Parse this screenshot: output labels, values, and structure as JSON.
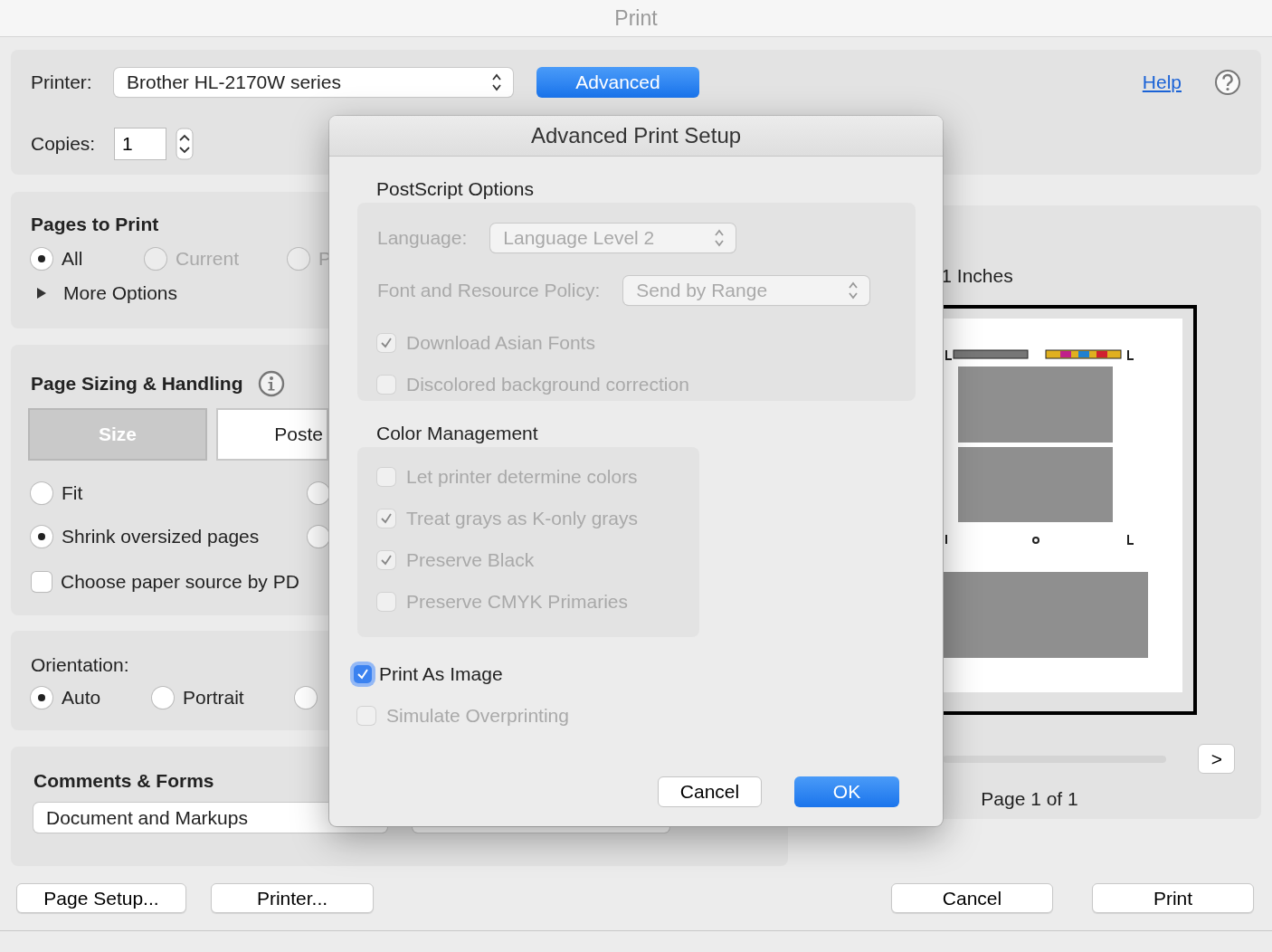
{
  "window": {
    "title": "Print"
  },
  "printer": {
    "label": "Printer:",
    "value": "Brother HL-2170W series"
  },
  "advanced_button": "Advanced",
  "help_link": "Help",
  "copies": {
    "label": "Copies:",
    "value": "1"
  },
  "pages_to_print": {
    "title": "Pages to Print",
    "options": [
      {
        "label": "All",
        "selected": true,
        "disabled": false
      },
      {
        "label": "Current",
        "selected": false,
        "disabled": true
      },
      {
        "label": "P",
        "selected": false,
        "disabled": true
      }
    ],
    "more_options": "More Options"
  },
  "page_sizing": {
    "title": "Page Sizing & Handling",
    "tabs": [
      {
        "label": "Size",
        "selected": true
      },
      {
        "label": "Poste",
        "selected": false
      }
    ],
    "options": [
      {
        "label": "Fit",
        "selected": false
      },
      {
        "selected": false
      },
      {
        "label": "Shrink oversized pages",
        "selected": true
      },
      {
        "selected": false
      }
    ],
    "paper_source": {
      "label": "Choose paper source by PD",
      "checked": false
    }
  },
  "orientation": {
    "label": "Orientation:",
    "options": [
      {
        "label": "Auto",
        "selected": true
      },
      {
        "label": "Portrait",
        "selected": false
      },
      {
        "selected": false
      }
    ]
  },
  "comments_forms": {
    "title": "Comments & Forms",
    "value": "Document and Markups"
  },
  "buttons": {
    "page_setup": "Page Setup...",
    "printer": "Printer...",
    "cancel": "Cancel",
    "print": "Print"
  },
  "preview": {
    "scale": "1 Inches",
    "next": ">",
    "page": "Page 1 of 1"
  },
  "dialog": {
    "title": "Advanced Print Setup",
    "sections": [
      {
        "title": "PostScript Options",
        "rows": [
          {
            "kind": "select",
            "label": "Language:",
            "value": "Language Level 2",
            "disabled": true
          },
          {
            "kind": "select",
            "label": "Font and Resource Policy:",
            "value": "Send by Range",
            "disabled": true
          },
          {
            "kind": "checkbox",
            "label": "Download Asian Fonts",
            "checked": true,
            "disabled": true
          },
          {
            "kind": "checkbox",
            "label": "Discolored background correction",
            "checked": false,
            "disabled": true
          }
        ]
      },
      {
        "title": "Color Management",
        "rows": [
          {
            "kind": "checkbox",
            "label": "Let printer determine colors",
            "checked": false,
            "disabled": true
          },
          {
            "kind": "checkbox",
            "label": "Treat grays as K-only grays",
            "checked": true,
            "disabled": true
          },
          {
            "kind": "checkbox",
            "label": "Preserve Black",
            "checked": true,
            "disabled": true
          },
          {
            "kind": "checkbox",
            "label": "Preserve CMYK Primaries",
            "checked": false,
            "disabled": true
          }
        ]
      }
    ],
    "options": [
      {
        "label": "Print As Image",
        "checked": true,
        "disabled": false
      },
      {
        "label": "Simulate Overprinting",
        "checked": false,
        "disabled": true
      }
    ],
    "buttons": [
      {
        "label": "Cancel",
        "kind": "default"
      },
      {
        "label": "OK",
        "kind": "primary"
      }
    ]
  }
}
